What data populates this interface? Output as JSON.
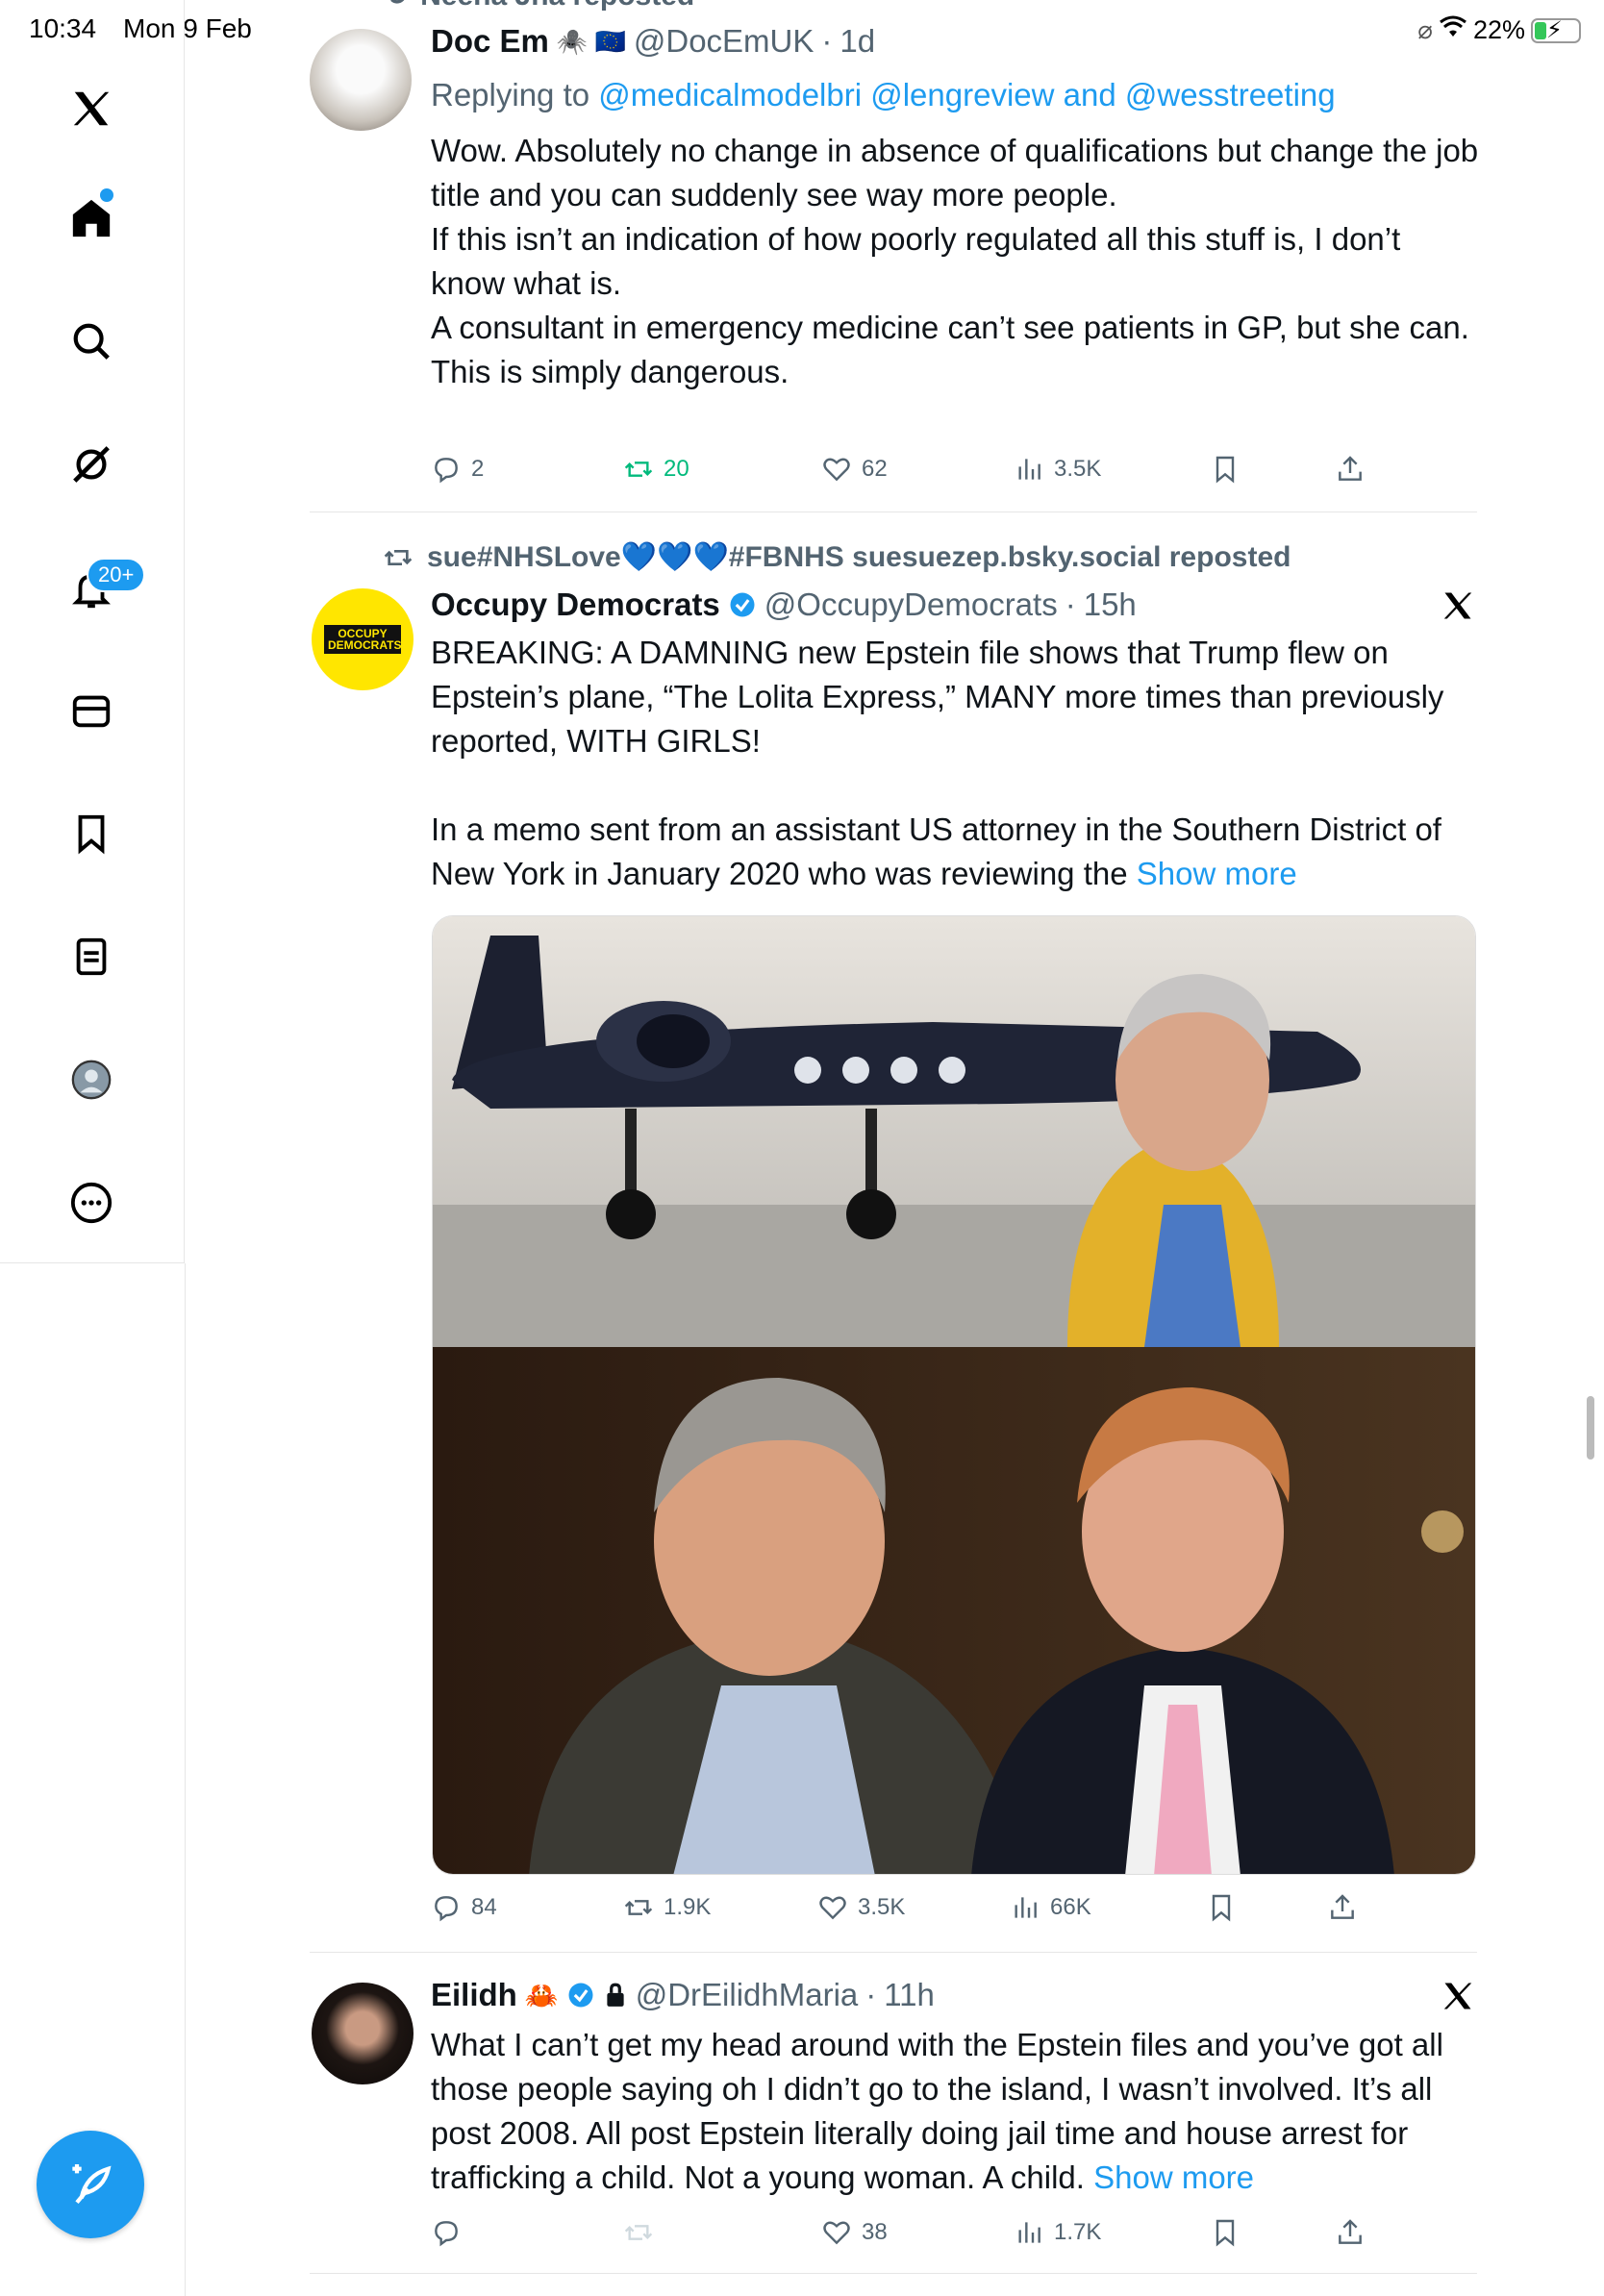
{
  "status_bar": {
    "time": "10:34",
    "date": "Mon 9 Feb",
    "battery": "22%"
  },
  "sidebar": {
    "items": [
      "x-logo",
      "home",
      "search",
      "grok",
      "notifications",
      "messages",
      "bookmarks",
      "lists",
      "profile",
      "more"
    ],
    "notifications_badge": "20+",
    "compose_label": "Post"
  },
  "feed": {
    "top_partial_repost": "Neena Jha reposted",
    "tweets": [
      {
        "name": "Doc Em",
        "name_emoji": "🕷️ 🇪🇺",
        "handle": "@DocEmUK",
        "sep": "·",
        "time": "1d",
        "reply_prefix": "Replying to",
        "reply_targets": "@medicalmodelbri @lengreview and @wesstreeting",
        "lines": [
          "Wow. Absolutely no change in absence of qualifications but change the job title and you can suddenly see way more people.",
          "If this isn’t an indication of how poorly regulated all this stuff is, I don’t know what is.",
          "A consultant in emergency medicine can’t see patients in GP,  but she can.",
          "This is simply dangerous."
        ],
        "replies": "2",
        "reposts": "20",
        "likes": "62",
        "views": "3.5K"
      },
      {
        "repost_by": "sue#NHSLove💙💙💙#FBNHS suesuezep.bsky.social reposted",
        "name": "Occupy Democrats",
        "handle": "@OccupyDemocrats",
        "sep": "·",
        "time": "15h",
        "avatar_text": "OCCUPY DEMOCRATS",
        "para1": "BREAKING: A DAMNING new Epstein file shows that Trump flew on Epstein’s plane, “The Lolita Express,” MANY more times than previously reported, WITH GIRLS!",
        "para2": "In a memo sent from an assistant US attorney in the Southern District of New York in January 2020 who was reviewing the",
        "show_more": "Show more",
        "replies": "84",
        "reposts": "1.9K",
        "likes": "3.5K",
        "views": "66K"
      },
      {
        "name": "Eilidh",
        "name_emoji": "🦀",
        "handle": "@DrEilidhMaria",
        "sep": "·",
        "time": "11h",
        "text": "What I can’t get my head around with the Epstein files and you’ve got all those people saying oh I didn’t go to the island, I wasn’t involved. It’s all post 2008. All post Epstein literally doing jail time and house arrest for trafficking a child. Not a young woman. A child.",
        "show_more": "Show more",
        "likes": "38",
        "views": "1.7K"
      }
    ]
  },
  "colors": {
    "accent": "#1d9bf0",
    "text": "#0f1419",
    "secondary": "#536471",
    "repost_green": "#00ba7c"
  }
}
